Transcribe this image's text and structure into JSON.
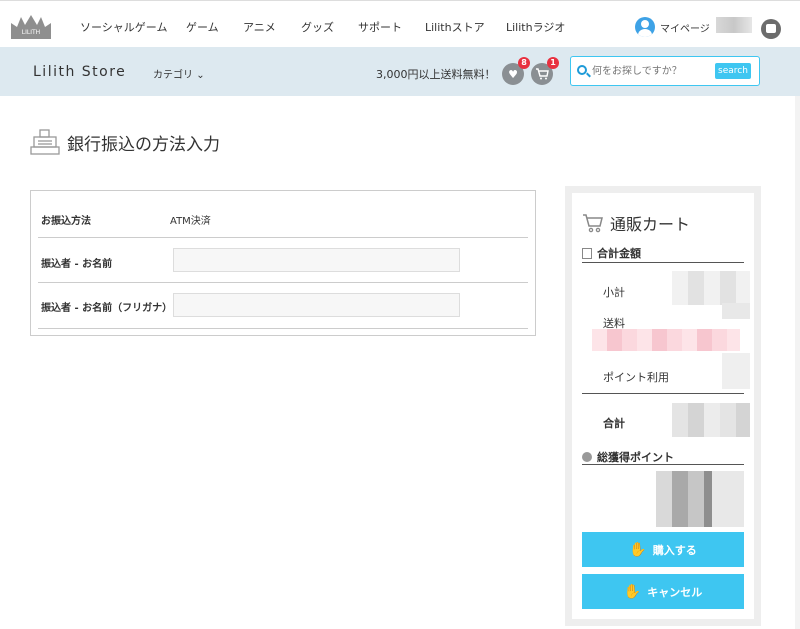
{
  "nav": {
    "logo_text": "LILITH",
    "items": [
      "ソーシャルゲーム",
      "ゲーム",
      "アニメ",
      "グッズ",
      "サポート",
      "Lilithストア",
      "Lilithラジオ"
    ],
    "mypage": "マイページ"
  },
  "store": {
    "name": "Lilith Store",
    "category": "カテゴリ",
    "shipping": "3,000円以上送料無料！",
    "wishlist_count": "8",
    "cart_count": "1",
    "search_placeholder": "何をお探しですか？",
    "search_button": "search"
  },
  "page": {
    "title": "銀行振込の方法入力"
  },
  "form": {
    "method_label": "お振込方法",
    "method_value": "ATM決済",
    "name_label": "振込者 - お名前",
    "kana_label": "振込者 - お名前（フリガナ）"
  },
  "cart": {
    "title": "通販カート",
    "total_section": "合計金額",
    "subtotal": "小計",
    "shipping": "送料",
    "points_used": "ポイント利用",
    "total": "合計",
    "earned_points": "総獲得ポイント",
    "buy_button": "購入する",
    "cancel_button": "キャンセル"
  },
  "colors": {
    "accent": "#3ec6f1",
    "storebar": "#dde9f0",
    "badge": "#e83140"
  }
}
